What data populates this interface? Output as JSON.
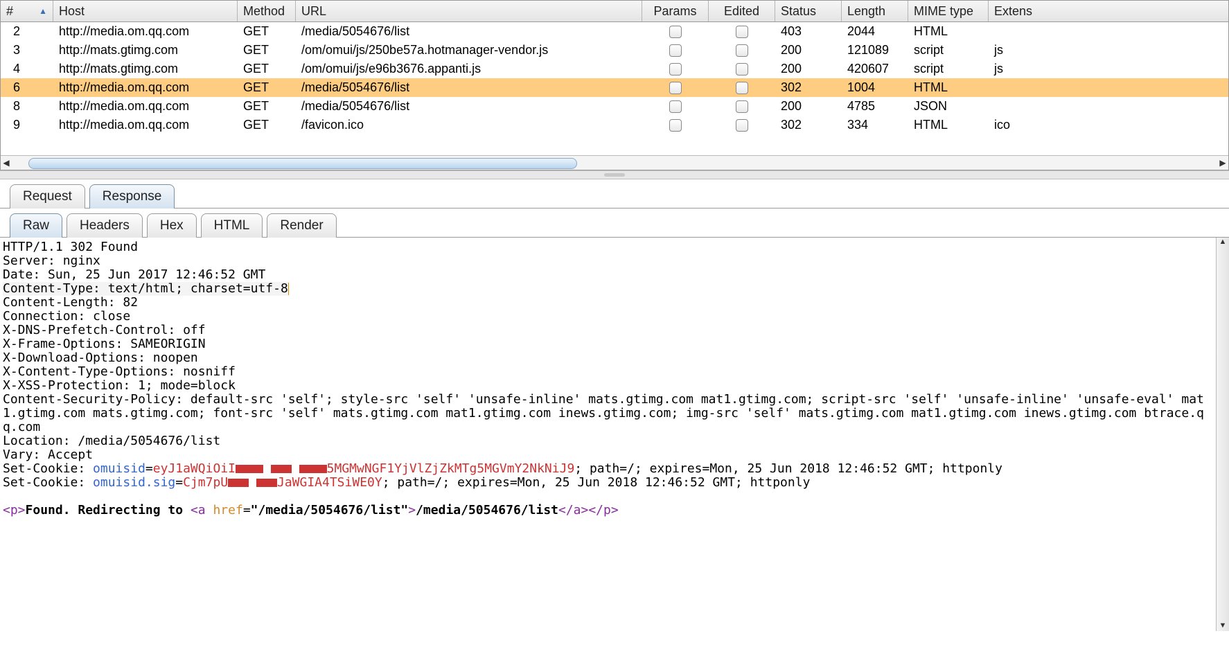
{
  "grid": {
    "columns": [
      "#",
      "Host",
      "Method",
      "URL",
      "Params",
      "Edited",
      "Status",
      "Length",
      "MIME type",
      "Extens"
    ],
    "sort_column_index": 0,
    "sort_direction": "asc",
    "rows": [
      {
        "num": "2",
        "host": "http://media.om.qq.com",
        "method": "GET",
        "url": "/media/5054676/list",
        "params": false,
        "edited": false,
        "status": "403",
        "length": "2044",
        "mime": "HTML",
        "ext": "",
        "selected": false
      },
      {
        "num": "3",
        "host": "http://mats.gtimg.com",
        "method": "GET",
        "url": "/om/omui/js/250be57a.hotmanager-vendor.js",
        "params": false,
        "edited": false,
        "status": "200",
        "length": "121089",
        "mime": "script",
        "ext": "js",
        "selected": false
      },
      {
        "num": "4",
        "host": "http://mats.gtimg.com",
        "method": "GET",
        "url": "/om/omui/js/e96b3676.appanti.js",
        "params": false,
        "edited": false,
        "status": "200",
        "length": "420607",
        "mime": "script",
        "ext": "js",
        "selected": false
      },
      {
        "num": "6",
        "host": "http://media.om.qq.com",
        "method": "GET",
        "url": "/media/5054676/list",
        "params": false,
        "edited": false,
        "status": "302",
        "length": "1004",
        "mime": "HTML",
        "ext": "",
        "selected": true
      },
      {
        "num": "8",
        "host": "http://media.om.qq.com",
        "method": "GET",
        "url": "/media/5054676/list",
        "params": false,
        "edited": false,
        "status": "200",
        "length": "4785",
        "mime": "JSON",
        "ext": "",
        "selected": false
      },
      {
        "num": "9",
        "host": "http://media.om.qq.com",
        "method": "GET",
        "url": "/favicon.ico",
        "params": false,
        "edited": false,
        "status": "302",
        "length": "334",
        "mime": "HTML",
        "ext": "ico",
        "selected": false
      }
    ]
  },
  "main_tabs": {
    "items": [
      "Request",
      "Response"
    ],
    "active": 1
  },
  "sub_tabs": {
    "items": [
      "Raw",
      "Headers",
      "Hex",
      "HTML",
      "Render"
    ],
    "active": 0
  },
  "response": {
    "status_line": "HTTP/1.1 302 Found",
    "headers": [
      "Server: nginx",
      "Date: Sun, 25 Jun 2017 12:46:52 GMT",
      "Content-Type: text/html; charset=utf-8",
      "Content-Length: 82",
      "Connection: close",
      "X-DNS-Prefetch-Control: off",
      "X-Frame-Options: SAMEORIGIN",
      "X-Download-Options: noopen",
      "X-Content-Type-Options: nosniff",
      "X-XSS-Protection: 1; mode=block",
      "Content-Security-Policy: default-src 'self'; style-src 'self' 'unsafe-inline' mats.gtimg.com mat1.gtimg.com; script-src 'self' 'unsafe-inline' 'unsafe-eval' mat1.gtimg.com mats.gtimg.com; font-src 'self' mats.gtimg.com mat1.gtimg.com inews.gtimg.com; img-src 'self' mats.gtimg.com mat1.gtimg.com inews.gtimg.com btrace.qq.com",
      "Location: /media/5054676/list",
      "Vary: Accept"
    ],
    "cookie1_name": "omuisid",
    "cookie1_value_prefix": "eyJ1aWQiOiI",
    "cookie1_censored": "██ ██ ██",
    "cookie1_value_suffix": "5MGMwNGF1YjVlZjZkMTg5MGVmY2NkNiJ9",
    "cookie1_attrs": "; path=/; expires=Mon, 25 Jun 2018 12:46:52 GMT; httponly",
    "cookie2_name": "omuisid.sig",
    "cookie2_value_prefix": "Cjm7pU",
    "cookie2_censored": "██ ██",
    "cookie2_value_suffix": "JaWGIA4TSiWE0Y",
    "cookie2_attrs": "; path=/; expires=Mon, 25 Jun 2018 12:46:52 GMT; httponly",
    "body_found": "Found. Redirecting to ",
    "body_href": "/media/5054676/list",
    "body_linktext": "/media/5054676/list"
  },
  "cursor_line_index": 3
}
